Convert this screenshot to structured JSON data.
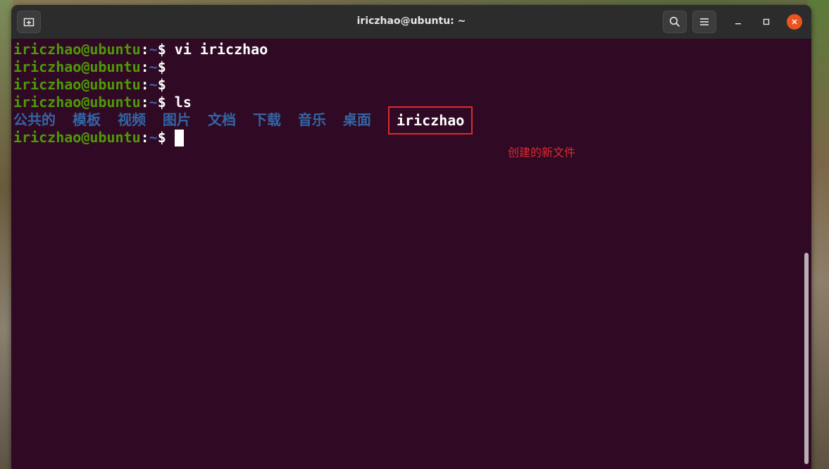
{
  "window": {
    "title": "iriczhao@ubuntu: ~"
  },
  "titlebar": {
    "new_tab_icon": "new-tab-icon",
    "search_icon": "search-icon",
    "menu_icon": "hamburger-menu-icon",
    "minimize_icon": "minimize-icon",
    "maximize_icon": "maximize-icon",
    "close_icon": "close-icon"
  },
  "terminal": {
    "prompt_user": "iriczhao@ubuntu",
    "prompt_sep": ":",
    "prompt_path": "~",
    "prompt_dollar": "$",
    "lines": [
      {
        "command": " vi iriczhao"
      },
      {
        "command": ""
      },
      {
        "command": ""
      },
      {
        "command": " ls"
      }
    ],
    "ls_output": {
      "dirs": [
        "公共的",
        "模板",
        "视频",
        "图片",
        "文档",
        "下载",
        "音乐",
        "桌面"
      ],
      "file": "iriczhao"
    },
    "final_prompt_command": " "
  },
  "annotation": {
    "text": "创建的新文件",
    "color": "#e0282e"
  },
  "colors": {
    "background": "#300a24",
    "user": "#4e9a06",
    "path": "#3465a4",
    "text": "#ffffff",
    "close": "#e95420"
  }
}
